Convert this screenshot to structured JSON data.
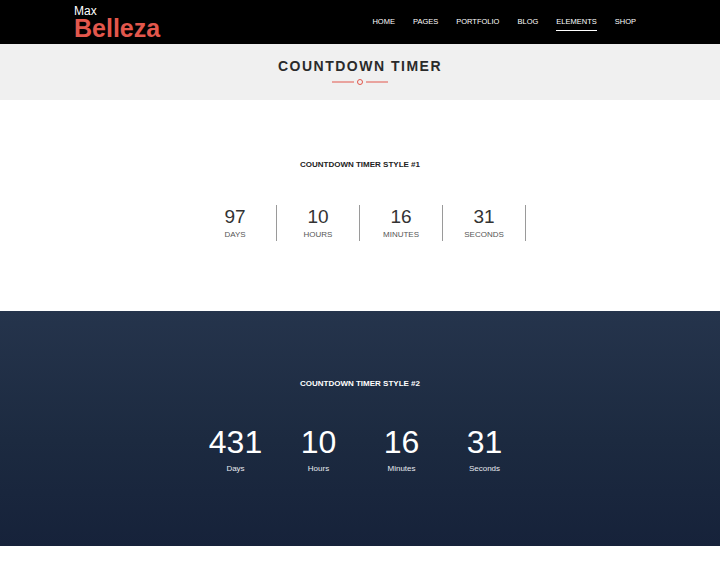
{
  "header": {
    "logo": {
      "small": "Max",
      "large": "Belleza"
    },
    "nav": [
      {
        "label": "HOME",
        "selected": false
      },
      {
        "label": "PAGES",
        "selected": false
      },
      {
        "label": "PORTFOLIO",
        "selected": false
      },
      {
        "label": "BLOG",
        "selected": false
      },
      {
        "label": "ELEMENTS",
        "selected": true
      },
      {
        "label": "SHOP",
        "selected": false
      }
    ]
  },
  "page_title": "COUNTDOWN TIMER",
  "timers": [
    {
      "title": "COUNTDOWN TIMER STYLE #1",
      "kind": "bordered",
      "units": [
        {
          "value": "97",
          "label": "DAYS"
        },
        {
          "value": "10",
          "label": "HOURS"
        },
        {
          "value": "16",
          "label": "MINUTES"
        },
        {
          "value": "31",
          "label": "SECONDS"
        }
      ]
    },
    {
      "title": "COUNTDOWN TIMER STYLE #2",
      "kind": "overlay",
      "units": [
        {
          "value": "431",
          "label": "Days"
        },
        {
          "value": "10",
          "label": "Hours"
        },
        {
          "value": "16",
          "label": "Minutes"
        },
        {
          "value": "31",
          "label": "Seconds"
        }
      ]
    }
  ]
}
